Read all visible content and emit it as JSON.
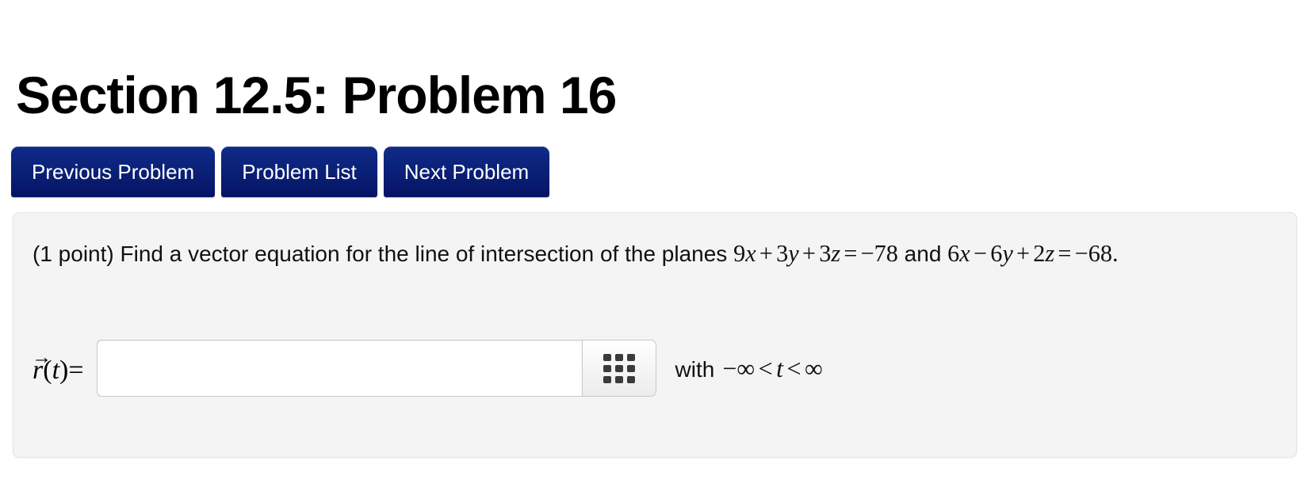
{
  "page": {
    "title": "Section 12.5: Problem 16"
  },
  "nav": {
    "buttons": [
      {
        "label": "Previous Problem",
        "name": "previous-problem-button"
      },
      {
        "label": "Problem List",
        "name": "problem-list-button"
      },
      {
        "label": "Next Problem",
        "name": "next-problem-button"
      }
    ]
  },
  "problem": {
    "points_label": "(1 point)",
    "prompt_part1": "Find a vector equation for the line of intersection of the planes",
    "plane1": {
      "full": "9x + 3y + 3z = −78",
      "term1_coef": "9",
      "term1_var": "x",
      "op1": "+",
      "term2_coef": "3",
      "term2_var": "y",
      "op2": "+",
      "term3_coef": "3",
      "term3_var": "z",
      "equals": "=",
      "rhs": "−78"
    },
    "conjunction": "and",
    "plane2": {
      "full": "6x − 6y + 2z = −68",
      "term1_coef": "6",
      "term1_var": "x",
      "op1": "−",
      "term2_coef": "6",
      "term2_var": "y",
      "op2": "+",
      "term3_coef": "2",
      "term3_var": "z",
      "equals": "=",
      "rhs": "−68",
      "period": "."
    }
  },
  "answer": {
    "label_r": "r",
    "label_arrow": "→",
    "label_paren_open": "(",
    "label_var": "t",
    "label_paren_close": ")",
    "label_equals": "=",
    "input_value": "",
    "input_placeholder": "",
    "grid_button_icon": "grid-3x3-icon",
    "with_word": "with",
    "range": "−∞ < t < ∞",
    "range_neg_inf": "−∞",
    "range_lt1": "<",
    "range_var": "t",
    "range_lt2": "<",
    "range_pos_inf": "∞"
  },
  "colors": {
    "button_navy_top": "#0f2a86",
    "button_navy_bottom": "#061363",
    "panel_bg": "#f4f4f4",
    "panel_border": "#e3e3e3",
    "text": "#111111",
    "icon_dark": "#3b3b3b"
  }
}
